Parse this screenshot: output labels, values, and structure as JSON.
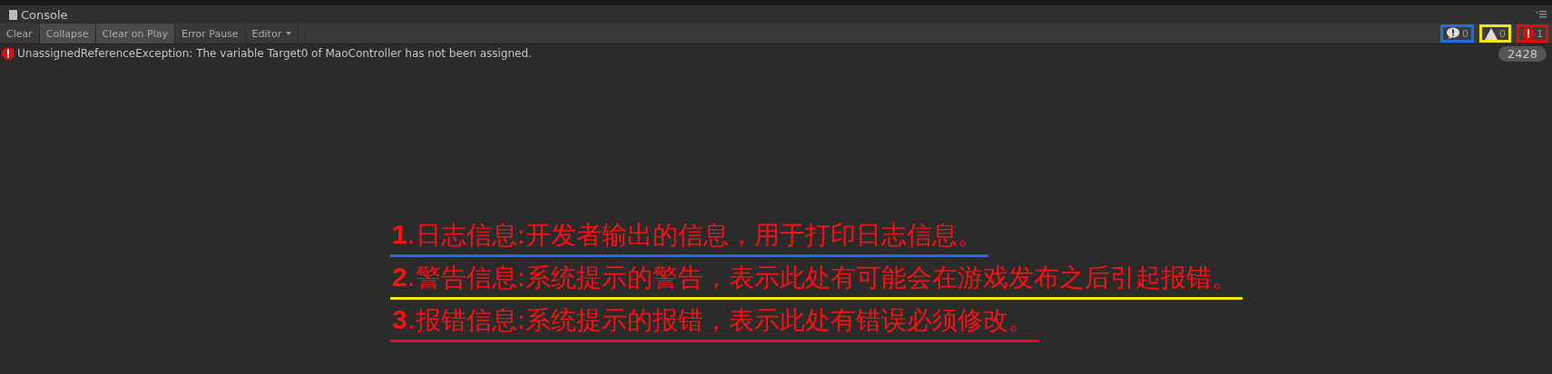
{
  "window": {
    "title": "Console"
  },
  "toolbar": [
    {
      "label": "Clear",
      "selected": false,
      "kind": "button"
    },
    {
      "label": "Collapse",
      "selected": true,
      "kind": "button"
    },
    {
      "label": "Clear on Play",
      "selected": true,
      "kind": "button"
    },
    {
      "label": "Error Pause",
      "selected": false,
      "kind": "button"
    },
    {
      "label": "Editor",
      "selected": false,
      "kind": "dropdown"
    }
  ],
  "counters": [
    {
      "kind": "info",
      "count": "0",
      "color": "#1e6fe6"
    },
    {
      "kind": "warning",
      "count": "0",
      "color": "#f2e60c"
    },
    {
      "kind": "error",
      "count": "1",
      "color": "#e00d0d"
    }
  ],
  "log": [
    {
      "kind": "error",
      "message": "UnassignedReferenceException: The variable Target0 of MaoController has not been assigned.",
      "count": "2428"
    }
  ],
  "annotations": [
    {
      "number": "1",
      "text": ".日志信息:开发者输出的信息，用于打印日志信息。",
      "color": "#1e6fe6"
    },
    {
      "number": "2",
      "text": ".警告信息:系统提示的警告，表示此处有可能会在游戏发布之后引起报错。",
      "color": "#f2e60c"
    },
    {
      "number": "3",
      "text": ".报错信息:系统提示的报错，表示此处有错误必须修改。",
      "color": "#e00d0d"
    }
  ]
}
